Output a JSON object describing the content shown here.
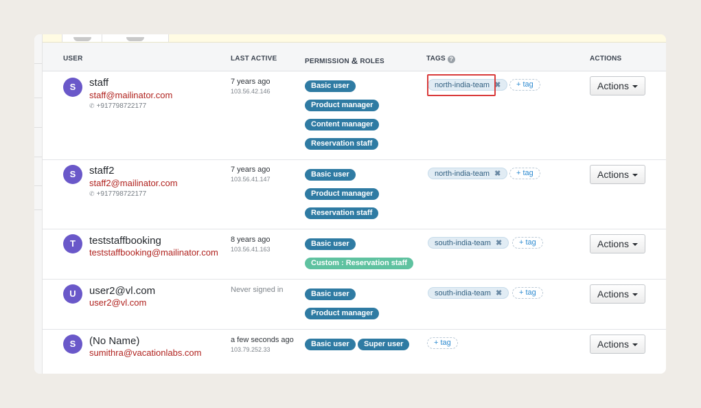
{
  "table": {
    "headers": {
      "user": "USER",
      "last_active": "LAST ACTIVE",
      "permission_a": "PERMISSION",
      "permission_amp": "&",
      "permission_b": "ROLES",
      "tags": "TAGS",
      "tags_help": "?",
      "actions": "ACTIONS"
    },
    "actions_label": "Actions",
    "add_tag_label": "+ tag",
    "tag_remove_glyph": "✖",
    "phone_glyph": "✆",
    "rows": [
      {
        "initial": "S",
        "name": "staff",
        "email": "staff@mailinator.com",
        "phone": "+917798722177",
        "last_active": "7 years ago",
        "ip": "103.56.42.146",
        "roles": [
          "Basic user",
          "Product manager",
          "Content manager",
          "Reservation staff"
        ],
        "tags": [
          "north-india-team"
        ]
      },
      {
        "initial": "S",
        "name": "staff2",
        "email": "staff2@mailinator.com",
        "phone": "+917798722177",
        "last_active": "7 years ago",
        "ip": "103.56.41.147",
        "roles": [
          "Basic user",
          "Product manager",
          "Reservation staff"
        ],
        "tags": [
          "north-india-team"
        ]
      },
      {
        "initial": "T",
        "name": "teststaffbooking",
        "email": "teststaffbooking@mailinator.com",
        "phone": "",
        "last_active": "8 years ago",
        "ip": "103.56.41.163",
        "roles": [
          "Basic user",
          "Custom : Reservation staff"
        ],
        "tags": [
          "south-india-team"
        ]
      },
      {
        "initial": "U",
        "name": "user2@vl.com",
        "email": "user2@vl.com",
        "phone": "",
        "last_active": "Never signed in",
        "ip": "",
        "roles": [
          "Basic user",
          "Product manager"
        ],
        "tags": [
          "south-india-team"
        ]
      },
      {
        "initial": "S",
        "name": "(No Name)",
        "email": "sumithra@vacationlabs.com",
        "phone": "",
        "last_active": "a few seconds ago",
        "ip": "103.79.252.33",
        "roles": [
          "Basic user",
          "Super user"
        ],
        "tags": []
      }
    ]
  },
  "colors": {
    "avatar": "#6a58c9",
    "role_badge": "#2f7ba3",
    "custom_role_badge": "#5fc2a0",
    "email": "#b0221e",
    "highlight": "#d93a3a"
  }
}
